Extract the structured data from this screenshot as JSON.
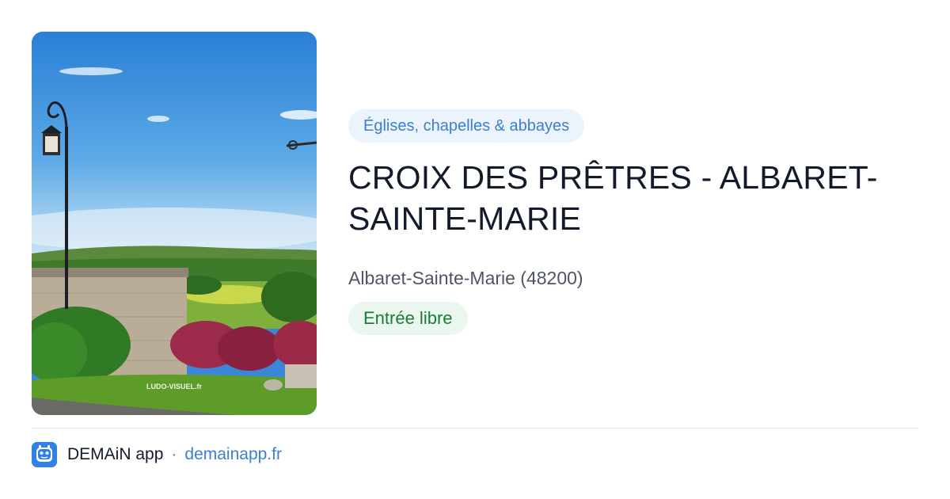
{
  "card": {
    "image": {
      "alt_icon": "landscape-photo",
      "watermark": "LUDO-VISUEL.fr"
    },
    "category": "Églises, chapelles & abbayes",
    "title": "CROIX DES PRÊTRES - ALBARET-SAINTE-MARIE",
    "location": "Albaret-Sainte-Marie (48200)",
    "access": "Entrée libre"
  },
  "footer": {
    "app_icon": "demain-app-icon",
    "app_name": "DEMAiN app",
    "separator": "·",
    "link": "demainapp.fr"
  },
  "colors": {
    "category_bg": "#ebf3fc",
    "category_text": "#3d7fd1",
    "access_bg": "#eaf7ee",
    "access_text": "#1f7a36",
    "link": "#3d7fd1",
    "brand": "#2f80e8"
  }
}
